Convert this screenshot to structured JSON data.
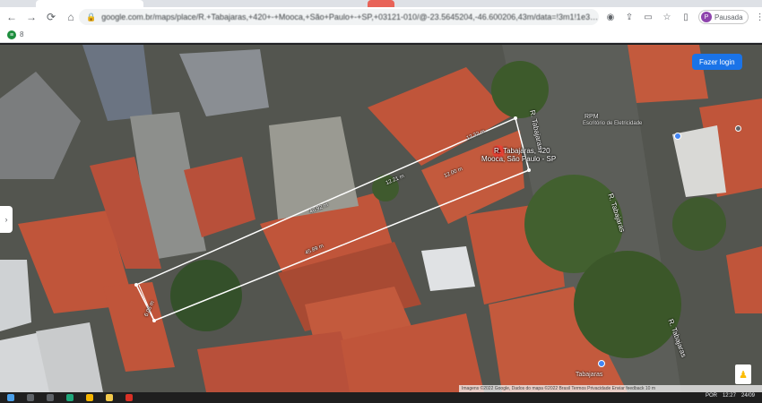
{
  "browser": {
    "url": "google.com.br/maps/place/R.+Tabajaras,+420+-+Mooca,+São+Paulo+-+SP,+03121-010/@-23.5645204,-46.600206,43m/data=!3m1!1e3!4m5",
    "profile_label": "Pausada",
    "profile_initial": "P",
    "bookmark_icon_text": "≡",
    "bookmark_label": "8"
  },
  "map": {
    "signin_label": "Fazer login",
    "pin_label_line1": "R. Tabajaras, 420",
    "pin_label_line2": "Mooca, São Paulo - SP",
    "street_labels": [
      "R. Tabajaras",
      "R. Tabajaras",
      "R. Tabajaras"
    ],
    "place_label_1": "RPM",
    "place_label_2": "Escritório de Eletricidade",
    "place_label_3": "Tabajaras",
    "attribution": "Imagens ©2022 Google, Dados do mapa ©2022   Brasil   Termos   Privacidade   Enviar feedback   10 m",
    "measurements": [
      "12.32 m",
      "46.92 m",
      "12.00 m",
      "45.89 m",
      "6.05 m",
      "12.21 m"
    ],
    "colors": {
      "roof": "#c0553a",
      "roof_dark": "#9b3f2a",
      "road": "#5a5c58",
      "tree": "#3f5a2e",
      "measure_line": "#ffffff",
      "pin": "#ea4335",
      "button": "#1a73e8"
    }
  },
  "taskbar": {
    "lang": "POR",
    "time": "12:27",
    "date": "24/09"
  }
}
